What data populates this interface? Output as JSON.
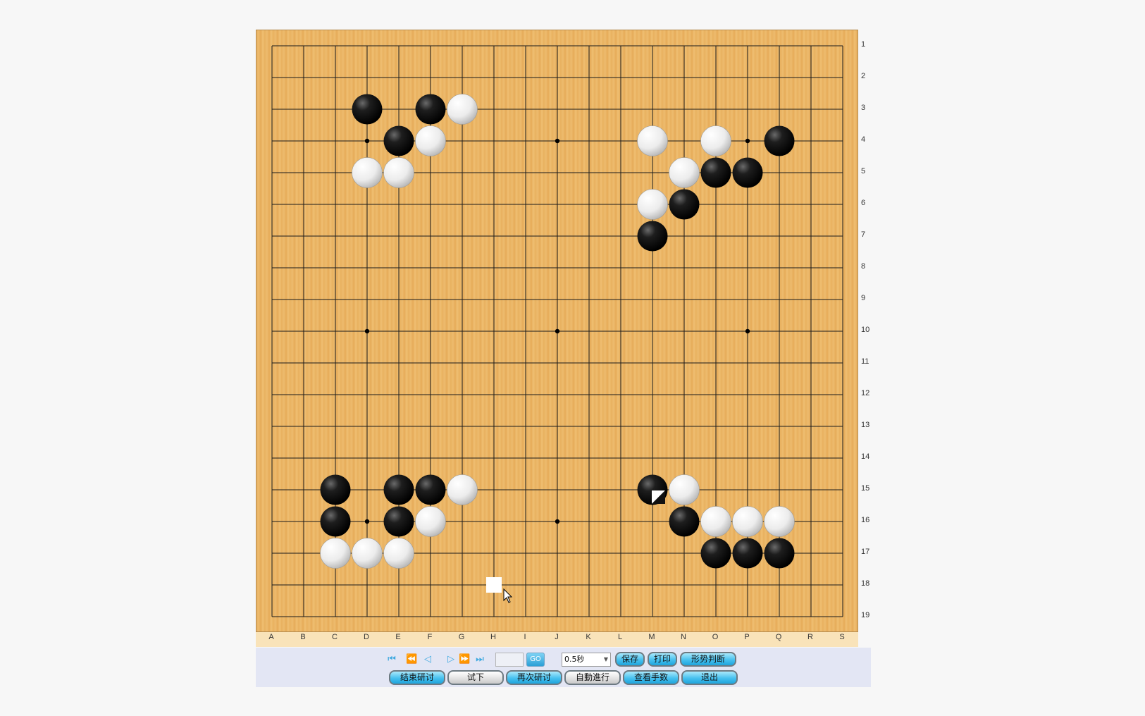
{
  "board": {
    "size": 19,
    "columns": [
      "A",
      "B",
      "C",
      "D",
      "E",
      "F",
      "G",
      "H",
      "I",
      "J",
      "K",
      "L",
      "M",
      "N",
      "O",
      "P",
      "Q",
      "R",
      "S"
    ],
    "rows": [
      "1",
      "2",
      "3",
      "4",
      "5",
      "6",
      "7",
      "8",
      "9",
      "10",
      "11",
      "12",
      "13",
      "14",
      "15",
      "16",
      "17",
      "18",
      "19"
    ],
    "hoshi": [
      [
        3,
        3
      ],
      [
        9,
        3
      ],
      [
        15,
        3
      ],
      [
        3,
        9
      ],
      [
        9,
        9
      ],
      [
        15,
        9
      ],
      [
        3,
        15
      ],
      [
        9,
        15
      ],
      [
        15,
        15
      ]
    ],
    "stones": [
      {
        "color": "black",
        "col": 3,
        "row": 2
      },
      {
        "color": "black",
        "col": 5,
        "row": 2
      },
      {
        "color": "white",
        "col": 6,
        "row": 2
      },
      {
        "color": "black",
        "col": 4,
        "row": 3
      },
      {
        "color": "white",
        "col": 5,
        "row": 3
      },
      {
        "color": "white",
        "col": 3,
        "row": 4
      },
      {
        "color": "white",
        "col": 4,
        "row": 4
      },
      {
        "color": "white",
        "col": 12,
        "row": 3
      },
      {
        "color": "white",
        "col": 14,
        "row": 3
      },
      {
        "color": "black",
        "col": 16,
        "row": 3
      },
      {
        "color": "white",
        "col": 13,
        "row": 4
      },
      {
        "color": "black",
        "col": 14,
        "row": 4
      },
      {
        "color": "black",
        "col": 15,
        "row": 4
      },
      {
        "color": "white",
        "col": 12,
        "row": 5
      },
      {
        "color": "black",
        "col": 13,
        "row": 5
      },
      {
        "color": "black",
        "col": 12,
        "row": 6
      },
      {
        "color": "black",
        "col": 2,
        "row": 14
      },
      {
        "color": "black",
        "col": 4,
        "row": 14
      },
      {
        "color": "black",
        "col": 5,
        "row": 14
      },
      {
        "color": "white",
        "col": 6,
        "row": 14
      },
      {
        "color": "black",
        "col": 2,
        "row": 15
      },
      {
        "color": "black",
        "col": 4,
        "row": 15
      },
      {
        "color": "white",
        "col": 5,
        "row": 15
      },
      {
        "color": "white",
        "col": 2,
        "row": 16
      },
      {
        "color": "white",
        "col": 3,
        "row": 16
      },
      {
        "color": "white",
        "col": 4,
        "row": 16
      },
      {
        "color": "black",
        "col": 12,
        "row": 14,
        "last": true
      },
      {
        "color": "white",
        "col": 13,
        "row": 14
      },
      {
        "color": "black",
        "col": 13,
        "row": 15
      },
      {
        "color": "white",
        "col": 14,
        "row": 15
      },
      {
        "color": "white",
        "col": 15,
        "row": 15
      },
      {
        "color": "white",
        "col": 16,
        "row": 15
      },
      {
        "color": "black",
        "col": 14,
        "row": 16
      },
      {
        "color": "black",
        "col": 15,
        "row": 16
      },
      {
        "color": "black",
        "col": 16,
        "row": 16
      }
    ],
    "hover_marker": {
      "col": 7,
      "row": 17
    },
    "colors": {
      "line": "#1a1a1a",
      "board": "#e9b261"
    }
  },
  "controls": {
    "nav_icons": [
      "first-move-icon",
      "prev-10-icon",
      "prev-move-icon",
      "next-move-icon",
      "next-10-icon",
      "last-move-icon"
    ],
    "move_input_value": "",
    "go_label": "GO",
    "speed_value": "0.5秒",
    "save_label": "保存",
    "print_label": "打印",
    "judge_label": "形势判断",
    "end_review_label": "结束研讨",
    "try_label": "试下",
    "review_again_label": "再次研讨",
    "auto_play_label": "自動進行",
    "view_moves_label": "查看手数",
    "exit_label": "退出"
  }
}
